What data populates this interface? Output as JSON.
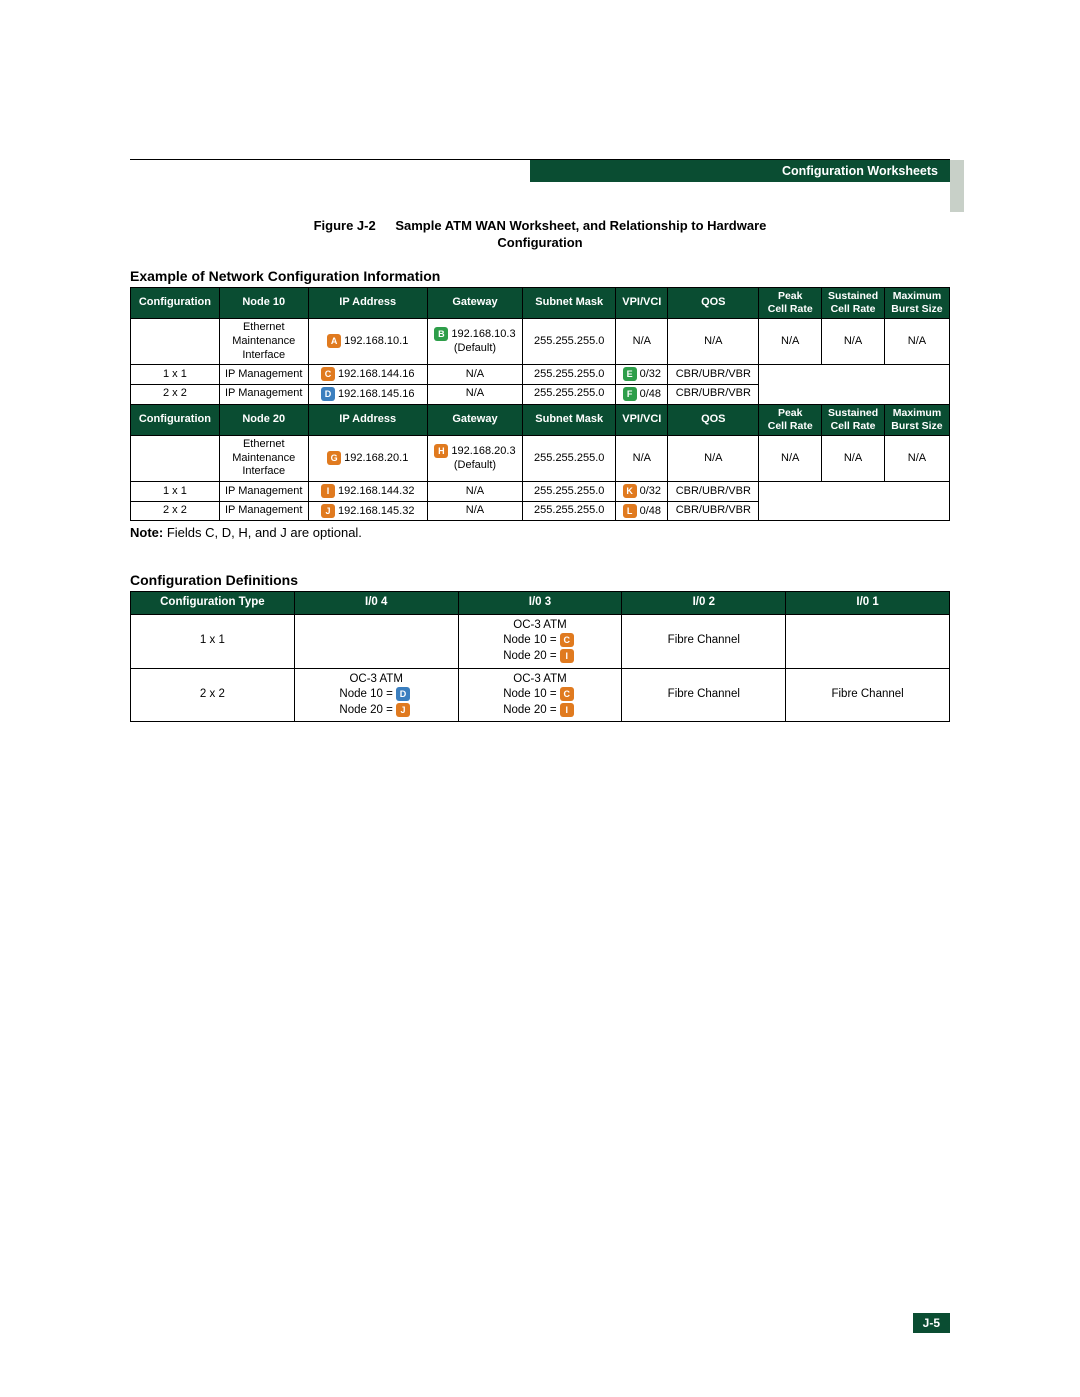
{
  "header": {
    "title": "Configuration Worksheets"
  },
  "figure": {
    "number": "Figure J-2",
    "title_l1": "Sample ATM WAN Worksheet, and Relationship to Hardware",
    "title_l2": "Configuration"
  },
  "section1_title": "Example of Network Configuration Information",
  "cols": {
    "conf": "Configuration",
    "node10": "Node 10",
    "node20": "Node 20",
    "ip": "IP Address",
    "gw": "Gateway",
    "mask": "Subnet Mask",
    "vpi": "VPI/VCI",
    "qos": "QOS",
    "peak_l1": "Peak",
    "peak_l2": "Cell Rate",
    "sus_l1": "Sustained",
    "sus_l2": "Cell Rate",
    "max_l1": "Maximum",
    "max_l2": "Burst Size"
  },
  "node10": {
    "r1": {
      "conf": "",
      "node": "Ethernet Maintenance Interface",
      "marker": "A",
      "ip": "192.168.10.1",
      "gw_marker": "B",
      "gw_l1": "192.168.10.3",
      "gw_l2": "(Default)",
      "mask": "255.255.255.0",
      "vpi": "N/A",
      "qos": "N/A",
      "peak": "N/A",
      "sus": "N/A",
      "max": "N/A"
    },
    "r2": {
      "conf": "1 x 1",
      "node": "IP Management",
      "marker": "C",
      "ip": "192.168.144.16",
      "gw": "N/A",
      "mask": "255.255.255.0",
      "vpi_marker": "E",
      "vpi": "0/32",
      "qos": "CBR/UBR/VBR"
    },
    "r3": {
      "conf": "2 x 2",
      "node": "IP Management",
      "marker": "D",
      "ip": "192.168.145.16",
      "gw": "N/A",
      "mask": "255.255.255.0",
      "vpi_marker": "F",
      "vpi": "0/48",
      "qos": "CBR/UBR/VBR"
    }
  },
  "node20": {
    "r1": {
      "conf": "",
      "node": "Ethernet Maintenance Interface",
      "marker": "G",
      "ip": "192.168.20.1",
      "gw_marker": "H",
      "gw_l1": "192.168.20.3",
      "gw_l2": "(Default)",
      "mask": "255.255.255.0",
      "vpi": "N/A",
      "qos": "N/A",
      "peak": "N/A",
      "sus": "N/A",
      "max": "N/A"
    },
    "r2": {
      "conf": "1 x 1",
      "node": "IP Management",
      "marker": "I",
      "ip": "192.168.144.32",
      "gw": "N/A",
      "mask": "255.255.255.0",
      "vpi_marker": "K",
      "vpi": "0/32",
      "qos": "CBR/UBR/VBR"
    },
    "r3": {
      "conf": "2 x 2",
      "node": "IP Management",
      "marker": "J",
      "ip": "192.168.145.32",
      "gw": "N/A",
      "mask": "255.255.255.0",
      "vpi_marker": "L",
      "vpi": "0/48",
      "qos": "CBR/UBR/VBR"
    }
  },
  "note": {
    "label": "Note:",
    "text": " Fields C, D, H, and J are optional."
  },
  "defs": {
    "title": "Configuration Definitions",
    "head": {
      "c1": "Configuration Type",
      "c2": "I/0 4",
      "c3": "I/0 3",
      "c4": "I/0 2",
      "c5": "I/0 1"
    },
    "r1": {
      "c1": "1 x 1",
      "c2": "",
      "c3_l1": "OC-3 ATM",
      "c3_l2a": "Node 10 = ",
      "c3_l2m": "C",
      "c3_l3a": "Node 20 = ",
      "c3_l3m": "I",
      "c4": "Fibre Channel",
      "c5": ""
    },
    "r2": {
      "c1": "2 x 2",
      "c2_l1": "OC-3 ATM",
      "c2_l2a": "Node 10 = ",
      "c2_l2m": "D",
      "c2_l3a": "Node 20 = ",
      "c2_l3m": "J",
      "c3_l1": "OC-3 ATM",
      "c3_l2a": "Node 10 = ",
      "c3_l2m": "C",
      "c3_l3a": "Node 20 = ",
      "c3_l3m": "I",
      "c4": "Fibre Channel",
      "c5": "Fibre Channel"
    }
  },
  "footer": {
    "page": "J-5"
  }
}
